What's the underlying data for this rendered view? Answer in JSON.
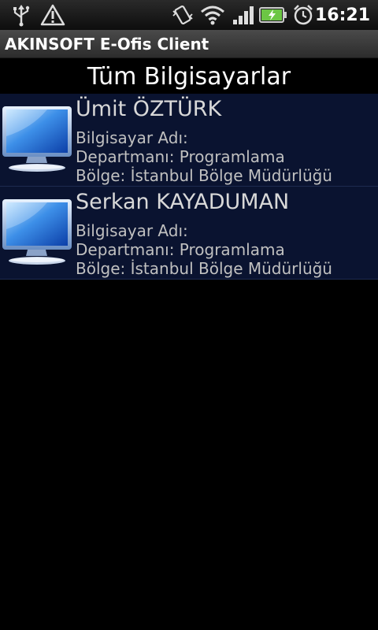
{
  "status_bar": {
    "time": "16:21",
    "icons": [
      "usb-icon",
      "warning-icon",
      "vibrate-icon",
      "wifi-icon",
      "signal-icon",
      "battery-charging-icon",
      "alarm-icon"
    ]
  },
  "app": {
    "title": "AKINSOFT E-Ofis Client"
  },
  "page": {
    "heading": "Tüm Bilgisayarlar"
  },
  "computers": [
    {
      "name": "Ümit ÖZTÜRK",
      "computer_name": "Bilgisayar Adı:",
      "department": "Departmanı: Programlama",
      "region": "Bölge: İstanbul Bölge Müdürlüğü"
    },
    {
      "name": "Serkan KAYADUMAN",
      "computer_name": "Bilgisayar Adı:",
      "department": "Departmanı: Programlama",
      "region": "Bölge: İstanbul Bölge Müdürlüğü"
    }
  ],
  "colors": {
    "row_background": "#0a1330",
    "title_bar": "#3a3a3a",
    "battery_green": "#6cc644"
  }
}
